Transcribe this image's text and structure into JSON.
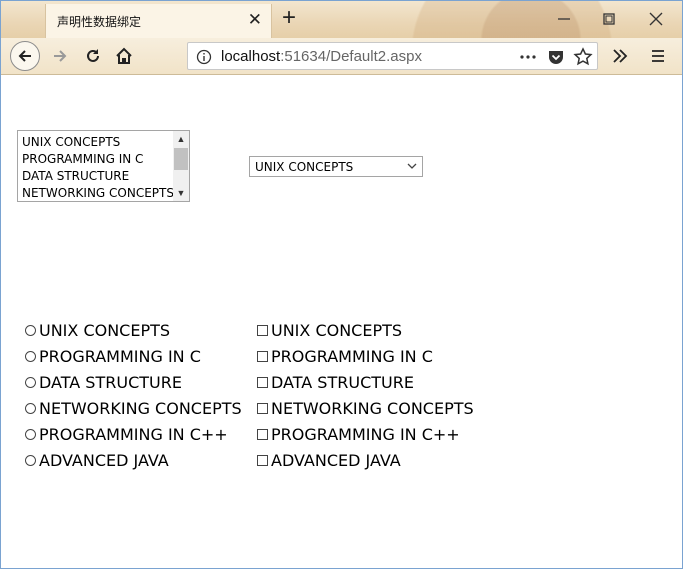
{
  "browser": {
    "tab_title": "声明性数据绑定",
    "url_host": "localhost",
    "url_rest": ":51634/Default2.aspx"
  },
  "icons": {
    "back": "back-arrow-icon",
    "forward": "forward-arrow-icon",
    "reload": "reload-icon",
    "home": "home-icon",
    "info": "info-icon",
    "more": "more-actions-icon",
    "pocket": "pocket-icon",
    "bookmark": "star-icon",
    "overflow": "double-chevron-icon",
    "menu": "hamburger-menu-icon"
  },
  "colors": {
    "window_border": "#7aa3d1",
    "theme_bg": "#ead6b5"
  },
  "listbox": {
    "items": [
      "UNIX CONCEPTS",
      "PROGRAMMING IN C",
      "DATA STRUCTURE",
      "NETWORKING CONCEPTS"
    ]
  },
  "dropdown": {
    "selected": "UNIX CONCEPTS"
  },
  "radio_list": {
    "items": [
      "UNIX CONCEPTS",
      "PROGRAMMING IN C",
      "DATA STRUCTURE",
      "NETWORKING CONCEPTS",
      "PROGRAMMING IN C++",
      "ADVANCED JAVA"
    ],
    "selected": null
  },
  "checkbox_list": {
    "items": [
      "UNIX CONCEPTS",
      "PROGRAMMING IN C",
      "DATA STRUCTURE",
      "NETWORKING CONCEPTS",
      "PROGRAMMING IN C++",
      "ADVANCED JAVA"
    ],
    "checked": []
  }
}
